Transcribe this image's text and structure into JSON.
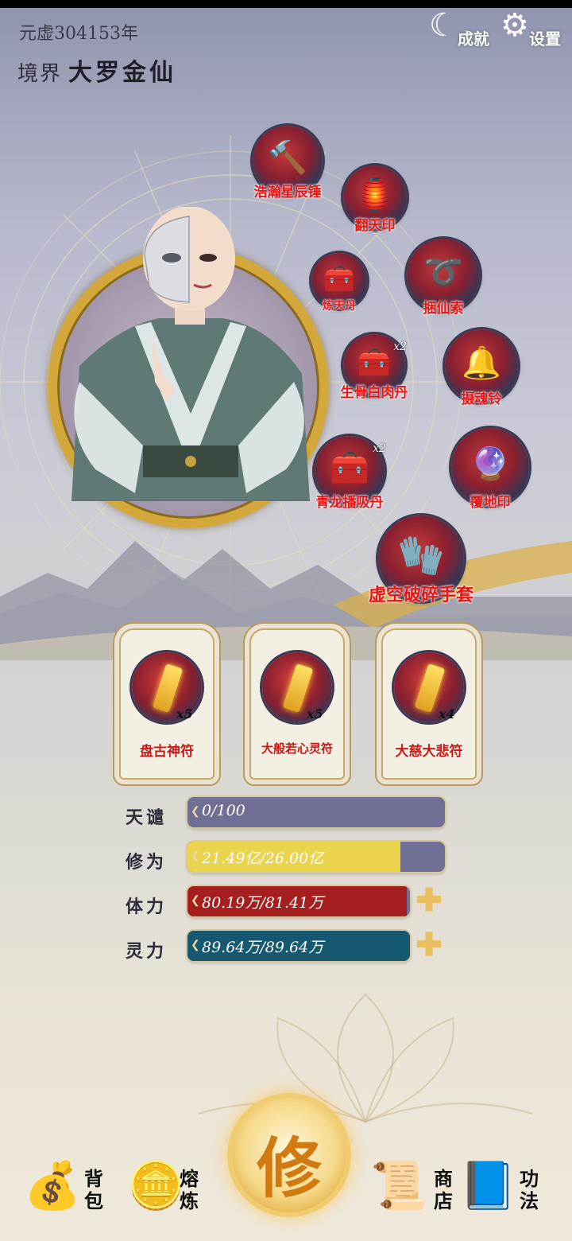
{
  "header": {
    "year_text": "元虚304153年",
    "realm_label": "境界",
    "realm_value": "大罗金仙"
  },
  "top_buttons": {
    "achievements_label": "成就",
    "settings_label": "设置"
  },
  "items": [
    {
      "name": "浩瀚星辰锤",
      "icon": "hammer-icon"
    },
    {
      "name": "翻天印",
      "icon": "seal-icon"
    },
    {
      "name": "炼天丹",
      "icon": "treasure-chest-icon"
    },
    {
      "name": "捆仙索",
      "icon": "rope-icon"
    },
    {
      "name": "生骨白肉丹",
      "icon": "treasure-chest-icon",
      "count": "x2"
    },
    {
      "name": "摄魂铃",
      "icon": "bell-icon"
    },
    {
      "name": "青龙播吸丹",
      "icon": "treasure-chest-icon",
      "count": "x2"
    },
    {
      "name": "覆地印",
      "icon": "orb-icon"
    },
    {
      "name": "虚空破碎手套",
      "icon": "gauntlet-icon"
    }
  ],
  "talismans": [
    {
      "name": "盘古神符",
      "count": "x5",
      "icon": "talisman-icon"
    },
    {
      "name": "大般若心灵符",
      "count": "x5",
      "icon": "talisman-icon"
    },
    {
      "name": "大慈大悲符",
      "count": "x4",
      "icon": "talisman-icon"
    }
  ],
  "stats": {
    "tribulation": {
      "label": "天谴",
      "text": "0/100",
      "fraction": 0.0
    },
    "cultivation": {
      "label": "修为",
      "text": "21.49亿/26.00亿",
      "fraction": 0.8265
    },
    "stamina": {
      "label": "体力",
      "text": "80.19万/81.41万",
      "fraction": 0.985
    },
    "spirit": {
      "label": "灵力",
      "text": "89.64万/89.64万",
      "fraction": 1.0
    }
  },
  "nav": {
    "bag": "背包",
    "smelt": "熔炼",
    "cultivate": "修",
    "shop": "商店",
    "techniques": "功法"
  },
  "colors": {
    "tribulation_track": "#6f6f95",
    "cultivation_fill": "#ecd34e",
    "stamina_fill": "#a51f1f",
    "spirit_fill": "#15586f",
    "item_name": "#e11111"
  }
}
